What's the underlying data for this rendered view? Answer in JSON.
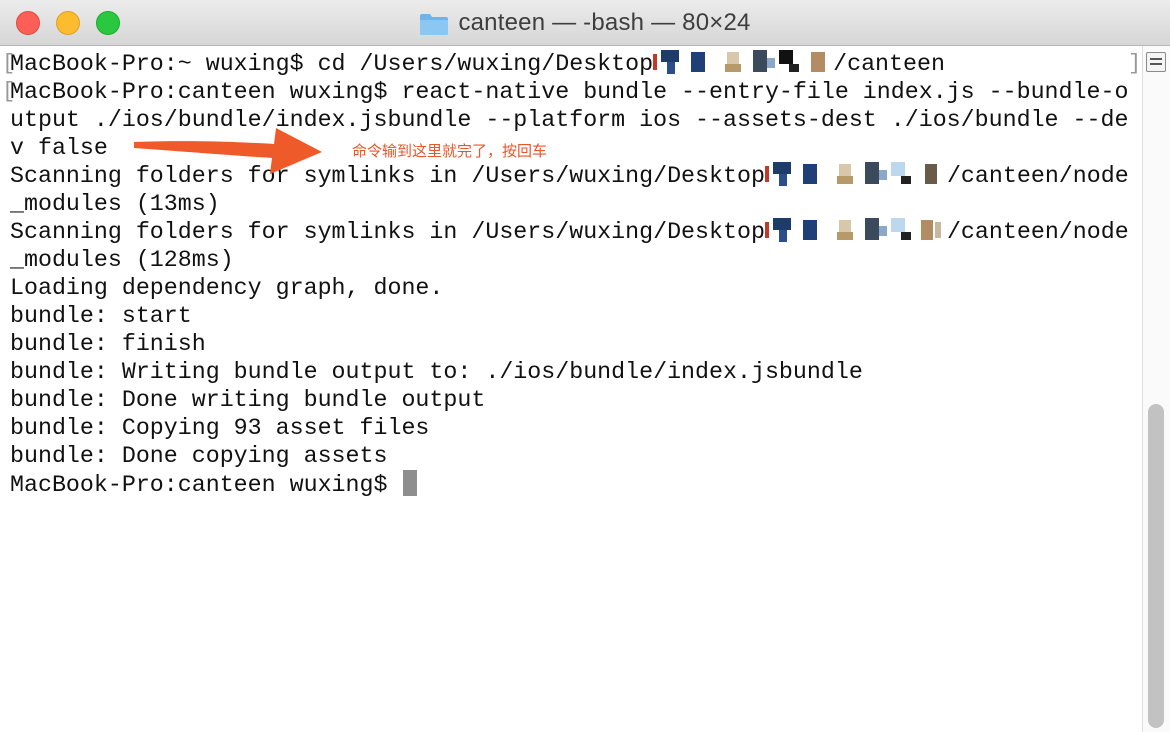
{
  "window": {
    "title": "canteen — -bash — 80×24",
    "icon": "folder-icon",
    "controls": [
      "close",
      "minimize",
      "zoom"
    ]
  },
  "terminal": {
    "lines": [
      {
        "pre": "MacBook-Pro:~ wuxing$ cd /Users/wuxing/Desktop",
        "redacted": true,
        "post": "/canteen"
      },
      {
        "pre": "MacBook-Pro:canteen wuxing$ react-native bundle --entry-file index.js --bundle-o"
      },
      {
        "pre": "utput ./ios/bundle/index.jsbundle --platform ios --assets-dest ./ios/bundle --de"
      },
      {
        "pre": "v false"
      },
      {
        "pre": "Scanning folders for symlinks in /Users/wuxing/Desktop",
        "redacted": true,
        "post": "/canteen/node"
      },
      {
        "pre": "_modules (13ms)"
      },
      {
        "pre": "Scanning folders for symlinks in /Users/wuxing/Desktop",
        "redacted": true,
        "post": "/canteen/node"
      },
      {
        "pre": "_modules (128ms)"
      },
      {
        "pre": "Loading dependency graph, done."
      },
      {
        "pre": "bundle: start"
      },
      {
        "pre": "bundle: finish"
      },
      {
        "pre": "bundle: Writing bundle output to: ./ios/bundle/index.jsbundle"
      },
      {
        "pre": "bundle: Done writing bundle output"
      },
      {
        "pre": "bundle: Copying 93 asset files"
      },
      {
        "pre": "bundle: Done copying assets"
      },
      {
        "pre": "MacBook-Pro:canteen wuxing$ ",
        "cursor": true
      }
    ]
  },
  "annotation": {
    "text": "命令输到这里就完了，按回车",
    "color": "#e8572a"
  },
  "colors": {
    "close": "#fc5f57",
    "minimize": "#fdbc2e",
    "zoom": "#29c840",
    "cursor": "#8e8e8e",
    "annotation_arrow": "#ef5a2a"
  }
}
